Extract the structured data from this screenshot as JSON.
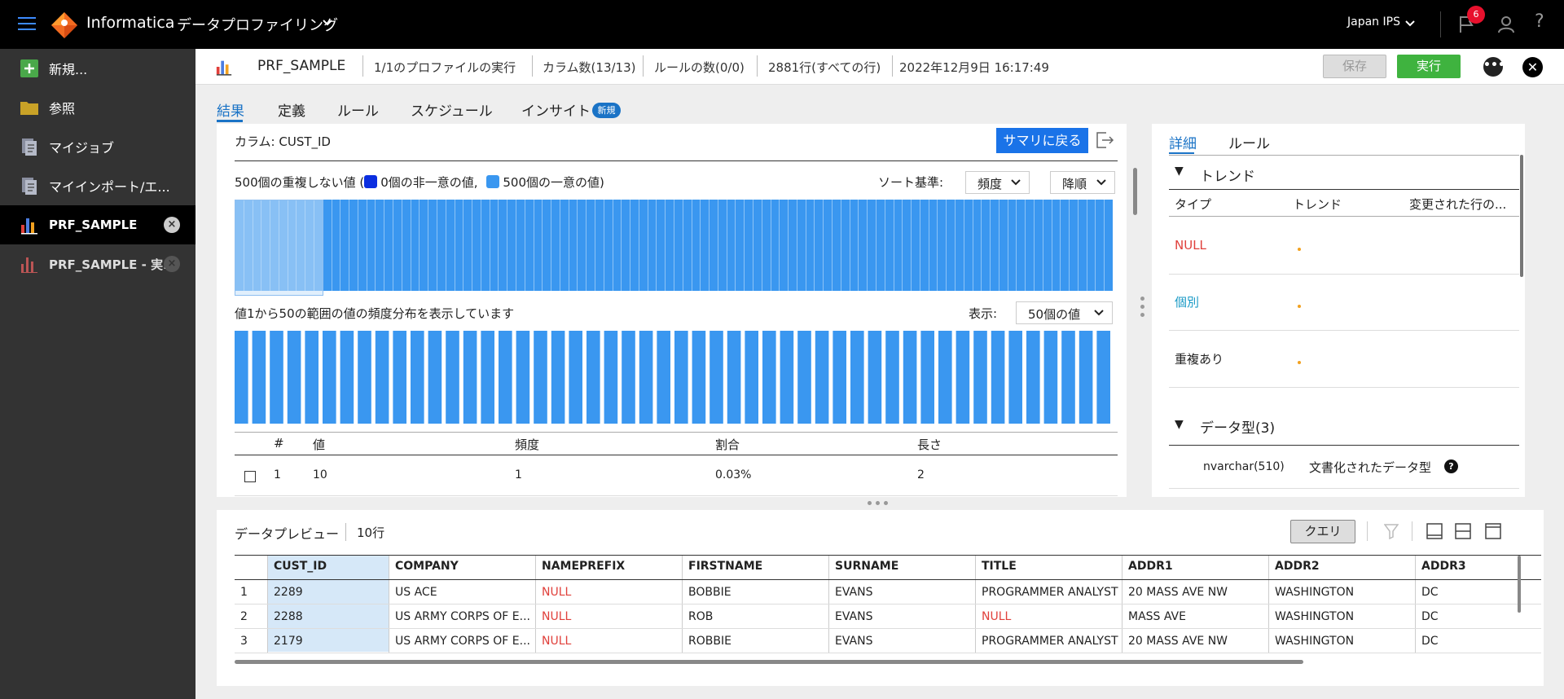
{
  "topbar": {
    "brand": "Informatica",
    "app_name": "データプロファイリング",
    "org": "Japan IPS",
    "notifications": "6",
    "help": "?"
  },
  "sidebar": {
    "items": [
      {
        "label": "新規...",
        "icon": "plus-icon"
      },
      {
        "label": "参照",
        "icon": "folder-icon"
      },
      {
        "label": "マイジョブ",
        "icon": "jobs-icon"
      },
      {
        "label": "マイインポート/エ...",
        "icon": "import-icon"
      },
      {
        "label": "PRF_SAMPLE",
        "icon": "chart-icon",
        "close": "×"
      },
      {
        "label": "PRF_SAMPLE - 実...",
        "icon": "chart-icon",
        "close": "×"
      }
    ]
  },
  "header": {
    "title": "PRF_SAMPLE",
    "runs": "1/1のプロファイルの実行",
    "columns": "カラム数(13/13)",
    "rules": "ルールの数(0/0)",
    "rows": "2881行(すべての行)",
    "timestamp": "2022年12月9日 16:17:49",
    "save": "保存",
    "run": "実行"
  },
  "tabs": [
    {
      "label": "結果"
    },
    {
      "label": "定義"
    },
    {
      "label": "ルール"
    },
    {
      "label": "スケジュール"
    },
    {
      "label": "インサイト"
    }
  ],
  "tab_badge": "新規",
  "column_panel": {
    "column_label": "カラム: CUST_ID",
    "back_button": "サマリに戻る",
    "distinct_prefix": "500個の重複しない値 (",
    "non_unique": "0個の非一意の値,",
    "unique": "500個の一意の値)",
    "sort_label": "ソート基準:",
    "sort_by": "頻度",
    "sort_order": "降順",
    "range_text": "値1から50の範囲の値の頻度分布を表示しています",
    "show_label": "表示:",
    "show_value": "50個の値",
    "colors": {
      "non_unique": "#0b2ee0",
      "unique": "#3a97f0",
      "bar": "#3a97f0"
    },
    "table": {
      "headers": [
        "#",
        "値",
        "頻度",
        "割合",
        "長さ"
      ],
      "rows": [
        {
          "num": "1",
          "value": "10",
          "freq": "1",
          "pct": "0.03%",
          "len": "2"
        }
      ]
    }
  },
  "right_panel": {
    "tabs": [
      "詳細",
      "ルール"
    ],
    "trend_title": "トレンド",
    "trend_headers": [
      "タイプ",
      "トレンド",
      "変更された行の..."
    ],
    "trend_rows": [
      {
        "type": "NULL",
        "color": "#e0403b"
      },
      {
        "type": "個別",
        "color": "#1a9ac6"
      },
      {
        "type": "重複あり",
        "color": "#222222"
      }
    ],
    "datatype_title": "データ型(3)",
    "datatype_value": "nvarchar(510)",
    "datatype_doc": "文書化されたデータ型",
    "info_icon": "?"
  },
  "preview": {
    "title": "データプレビュー",
    "count": "10行",
    "query_button": "クエリ",
    "headers": [
      "CUST_ID",
      "COMPANY",
      "NAMEPREFIX",
      "FIRSTNAME",
      "SURNAME",
      "TITLE",
      "ADDR1",
      "ADDR2",
      "ADDR3"
    ],
    "rows": [
      [
        "1",
        "2289",
        "US ACE",
        "NULL",
        "BOBBIE",
        "EVANS",
        "PROGRAMMER ANALYST",
        "20 MASS AVE NW",
        "WASHINGTON",
        "DC"
      ],
      [
        "2",
        "2288",
        "US ARMY CORPS OF E...",
        "NULL",
        "ROB",
        "EVANS",
        "NULL",
        "MASS AVE",
        "WASHINGTON",
        "DC"
      ],
      [
        "3",
        "2179",
        "US ARMY CORPS OF E...",
        "NULL",
        "ROBBIE",
        "EVANS",
        "PROGRAMMER ANALYST",
        "20 MASS AVE NW",
        "WASHINGTON",
        "DC"
      ]
    ]
  }
}
